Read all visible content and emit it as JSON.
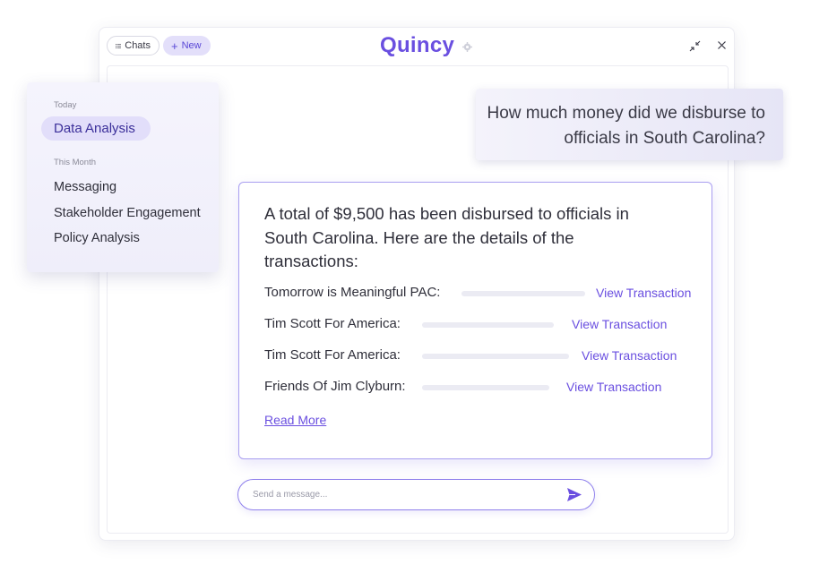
{
  "header": {
    "chats_label": "Chats",
    "new_label": "New",
    "brand": "Quincy"
  },
  "sidebar": {
    "sections": [
      {
        "title": "Today",
        "items": [
          {
            "label": "Data Analysis",
            "active": true
          }
        ]
      },
      {
        "title": "This Month",
        "items": [
          {
            "label": "Messaging"
          },
          {
            "label": "Stakeholder Engagement"
          },
          {
            "label": "Policy Analysis"
          }
        ]
      }
    ]
  },
  "conversation": {
    "question": "How much money did we disburse to officials in South Carolina?",
    "answer": "A total of $9,500 has been disbursed to officials in South Carolina. Here are the details of the transactions:",
    "transactions": [
      {
        "name": "Tomorrow is Meaningful PAC:",
        "link": "View Transaction"
      },
      {
        "name": "Tim Scott For America:",
        "link": "View Transaction"
      },
      {
        "name": "Tim Scott For America:",
        "link": "View Transaction"
      },
      {
        "name": "Friends Of Jim Clyburn:",
        "link": "View Transaction"
      }
    ],
    "read_more": "Read More"
  },
  "composer": {
    "placeholder": "Send a message...",
    "value": ""
  },
  "icons": {
    "list": "list-icon",
    "plus": "plus-icon",
    "settings": "gear-icon",
    "collapse": "collapse-icon",
    "close": "close-icon",
    "send": "send-icon"
  },
  "colors": {
    "accent": "#6a4fe0",
    "accent_soft": "#e2defa",
    "text": "#2f2f3a",
    "muted": "#8a8a98"
  }
}
